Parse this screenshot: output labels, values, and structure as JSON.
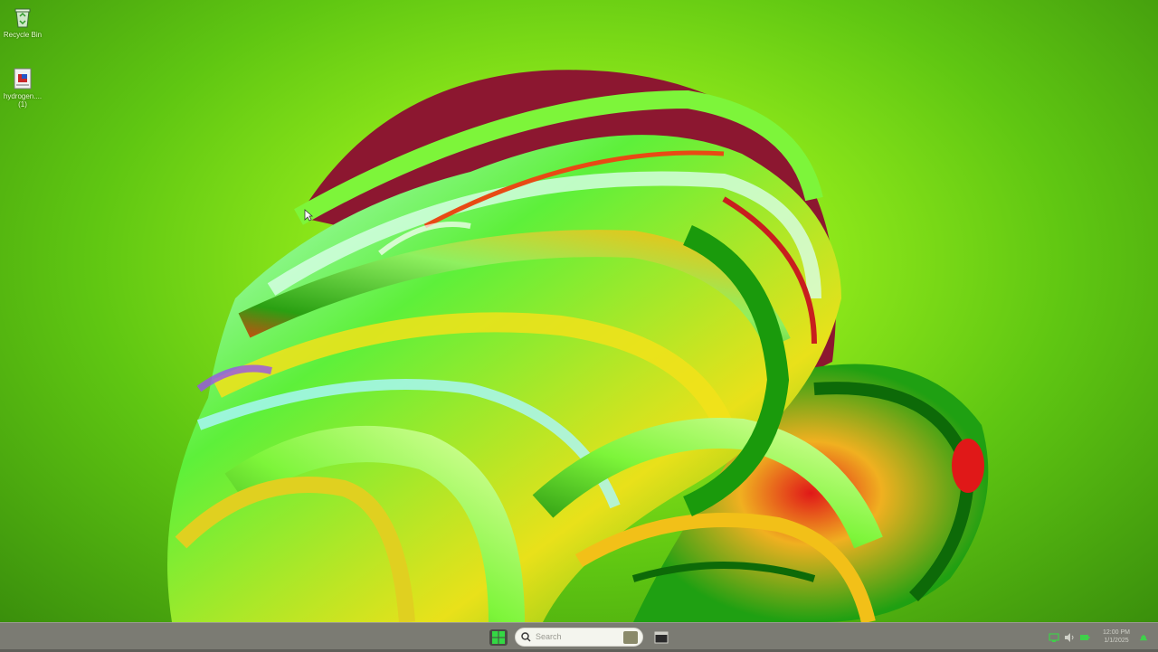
{
  "desktop": {
    "icons": [
      {
        "label": "Recycle Bin",
        "icon": "recycle-bin-icon"
      },
      {
        "label": "hydrogen....",
        "label_line2": "(1)",
        "icon": "document-file-icon"
      }
    ]
  },
  "taskbar": {
    "start_icon": "windows-start-icon",
    "search": {
      "placeholder": "Search"
    },
    "pinned": [
      {
        "icon": "app-window-icon"
      }
    ],
    "tray_icons": [
      "network-icon",
      "volume-icon",
      "battery-icon"
    ],
    "clock": {
      "time": "12:00 PM",
      "date": "1/1/2025"
    }
  },
  "colors": {
    "taskbar_bg": "#7b7b73",
    "wallpaper_center": "#c6f542",
    "wallpaper_edge": "#3a8f0c",
    "accent_green": "#34d844",
    "maroon": "#8c1730"
  }
}
